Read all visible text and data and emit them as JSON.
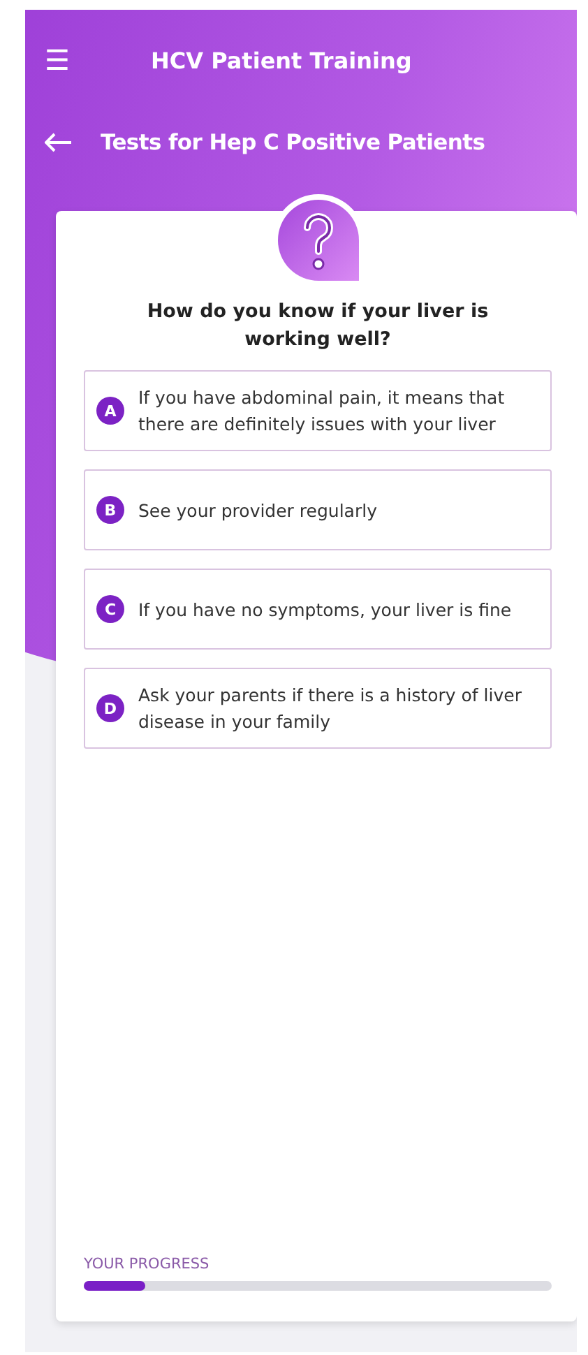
{
  "app_bar": {
    "menu_icon": "☰",
    "title": "HCV Patient Training"
  },
  "sub_header": {
    "title": "Tests for Hep C Positive Patients"
  },
  "question": {
    "text": "How do you know if your liver is working well?",
    "options": [
      {
        "letter": "A",
        "text": "If you have abdominal pain, it means that there are definitely issues with your liver",
        "selected": false
      },
      {
        "letter": "B",
        "text": "See your provider regularly",
        "selected": false
      },
      {
        "letter": "C",
        "text": "If you have no symptoms, your liver is fine",
        "selected": false
      },
      {
        "letter": "D",
        "text": "Ask your parents if there is a history of liver disease in your family",
        "selected": false
      }
    ]
  },
  "progress": {
    "label": "YOUR PROGRESS",
    "level": 0.13
  }
}
